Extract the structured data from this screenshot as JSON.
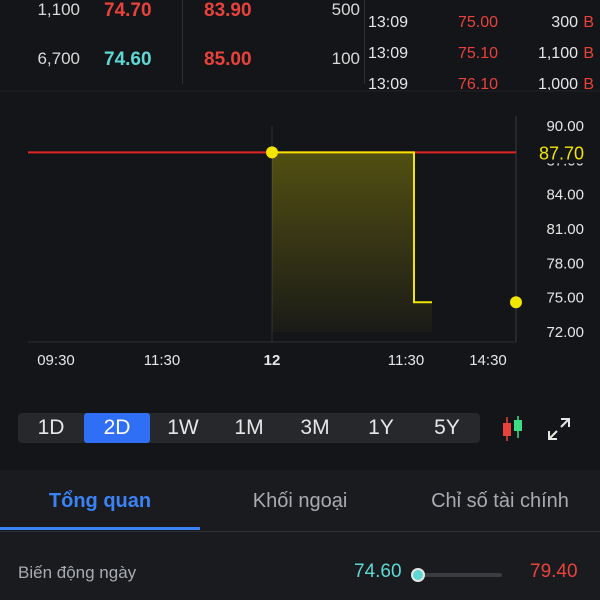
{
  "orderbook": {
    "rows": [
      {
        "vol": "1,100",
        "bid": "74.70",
        "ask": "83.90",
        "vol2": "500",
        "bid_color": "#e8423c"
      },
      {
        "vol": "6,700",
        "bid": "74.60",
        "ask": "85.00",
        "vol2": "100",
        "bid_color": "#5ed8d4"
      }
    ]
  },
  "trades": [
    {
      "time": "13:09",
      "price": "75.00",
      "vol": "300",
      "side": "B"
    },
    {
      "time": "13:09",
      "price": "75.10",
      "vol": "1,100",
      "side": "B"
    },
    {
      "time": "13:09",
      "price": "76.10",
      "vol": "1,000",
      "side": "B"
    }
  ],
  "chart_data": {
    "type": "line",
    "title": "",
    "xlabel": "",
    "ylabel": "",
    "x_ticks": [
      "09:30",
      "11:30",
      "12",
      "11:30",
      "14:30"
    ],
    "y_ticks": [
      "90.00",
      "87.00",
      "84.00",
      "81.00",
      "78.00",
      "75.00",
      "72.00"
    ],
    "ylim": [
      72,
      90
    ],
    "reference_price": 87.7,
    "reference_label": "87.70",
    "series": [
      {
        "x": [
          "day2 09:30",
          "day2 13:00",
          "day2 13:00",
          "day2 13:15"
        ],
        "y": [
          87.7,
          87.7,
          74.6,
          74.6
        ]
      }
    ],
    "start_marker_y": 87.7,
    "end_marker_y": 74.6,
    "colors": {
      "reference": "#e02424",
      "line": "#f2e500",
      "marker": "#f2e500"
    }
  },
  "timeframes": [
    "1D",
    "2D",
    "1W",
    "1M",
    "3M",
    "1Y",
    "5Y"
  ],
  "active_timeframe": "2D",
  "tabs": [
    "Tổng quan",
    "Khối ngoại",
    "Chỉ số tài chính"
  ],
  "active_tab": "Tổng quan",
  "daily_range": {
    "label": "Biến động ngày",
    "low": "74.60",
    "high": "79.40",
    "position": 0.0
  }
}
